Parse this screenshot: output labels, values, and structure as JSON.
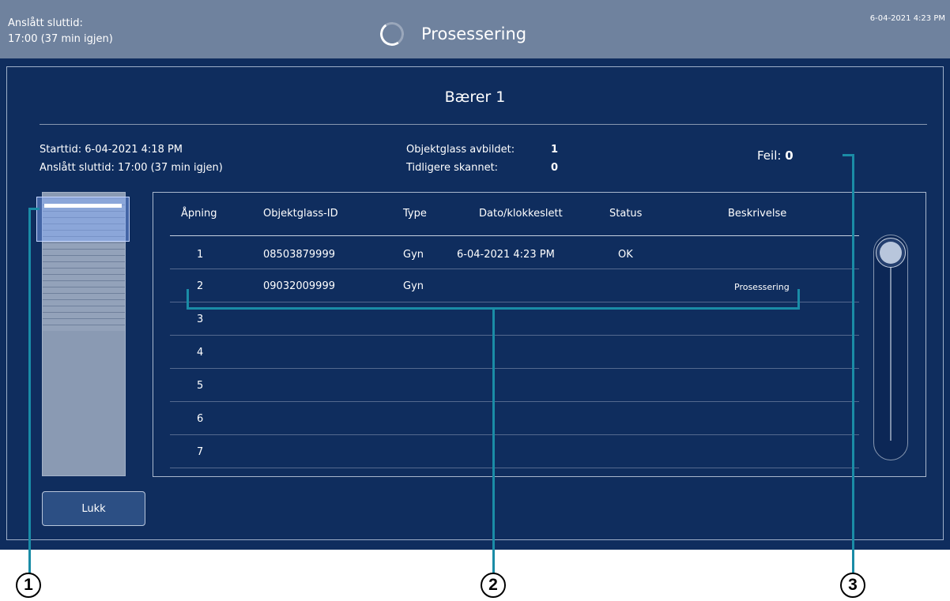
{
  "topbar": {
    "eta_label": "Anslått sluttid:",
    "eta_value": "17:00 (37 min igjen)",
    "title": "Prosessering",
    "clock": "6-04-2021 4:23 PM"
  },
  "carrier": {
    "title": "Bærer 1",
    "start_line": "Starttid:  6-04-2021 4:18 PM",
    "end_line": "Anslått sluttid:  17:00 (37 min igjen)",
    "imaged_label": "Objektglass avbildet:",
    "imaged_value": "1",
    "prev_label": "Tidligere skannet:",
    "prev_value": "0",
    "error_label": "Feil:",
    "error_value": "0"
  },
  "table": {
    "columns": [
      "Åpning",
      "Objektglass-ID",
      "Type",
      "Dato/klokkeslett",
      "Status",
      "Beskrivelse"
    ],
    "rows": [
      {
        "slot": "1",
        "id": "08503879999",
        "type": "Gyn",
        "datetime": "6-04-2021 4:23 PM",
        "status": "OK",
        "description": ""
      },
      {
        "slot": "2",
        "id": "09032009999",
        "type": "Gyn",
        "datetime": "",
        "status": "",
        "description": "Prosessering"
      },
      {
        "slot": "3",
        "id": "",
        "type": "",
        "datetime": "",
        "status": "",
        "description": ""
      },
      {
        "slot": "4",
        "id": "",
        "type": "",
        "datetime": "",
        "status": "",
        "description": ""
      },
      {
        "slot": "5",
        "id": "",
        "type": "",
        "datetime": "",
        "status": "",
        "description": ""
      },
      {
        "slot": "6",
        "id": "",
        "type": "",
        "datetime": "",
        "status": "",
        "description": ""
      },
      {
        "slot": "7",
        "id": "",
        "type": "",
        "datetime": "",
        "status": "",
        "description": ""
      }
    ]
  },
  "close_button": "Lukk",
  "callouts": [
    "1",
    "2",
    "3"
  ],
  "colors": {
    "topbar": "#6f829e",
    "panel": "#0f2d5e",
    "callout": "#1a8ca6"
  },
  "icons": {
    "spinner": "spinner-icon"
  }
}
